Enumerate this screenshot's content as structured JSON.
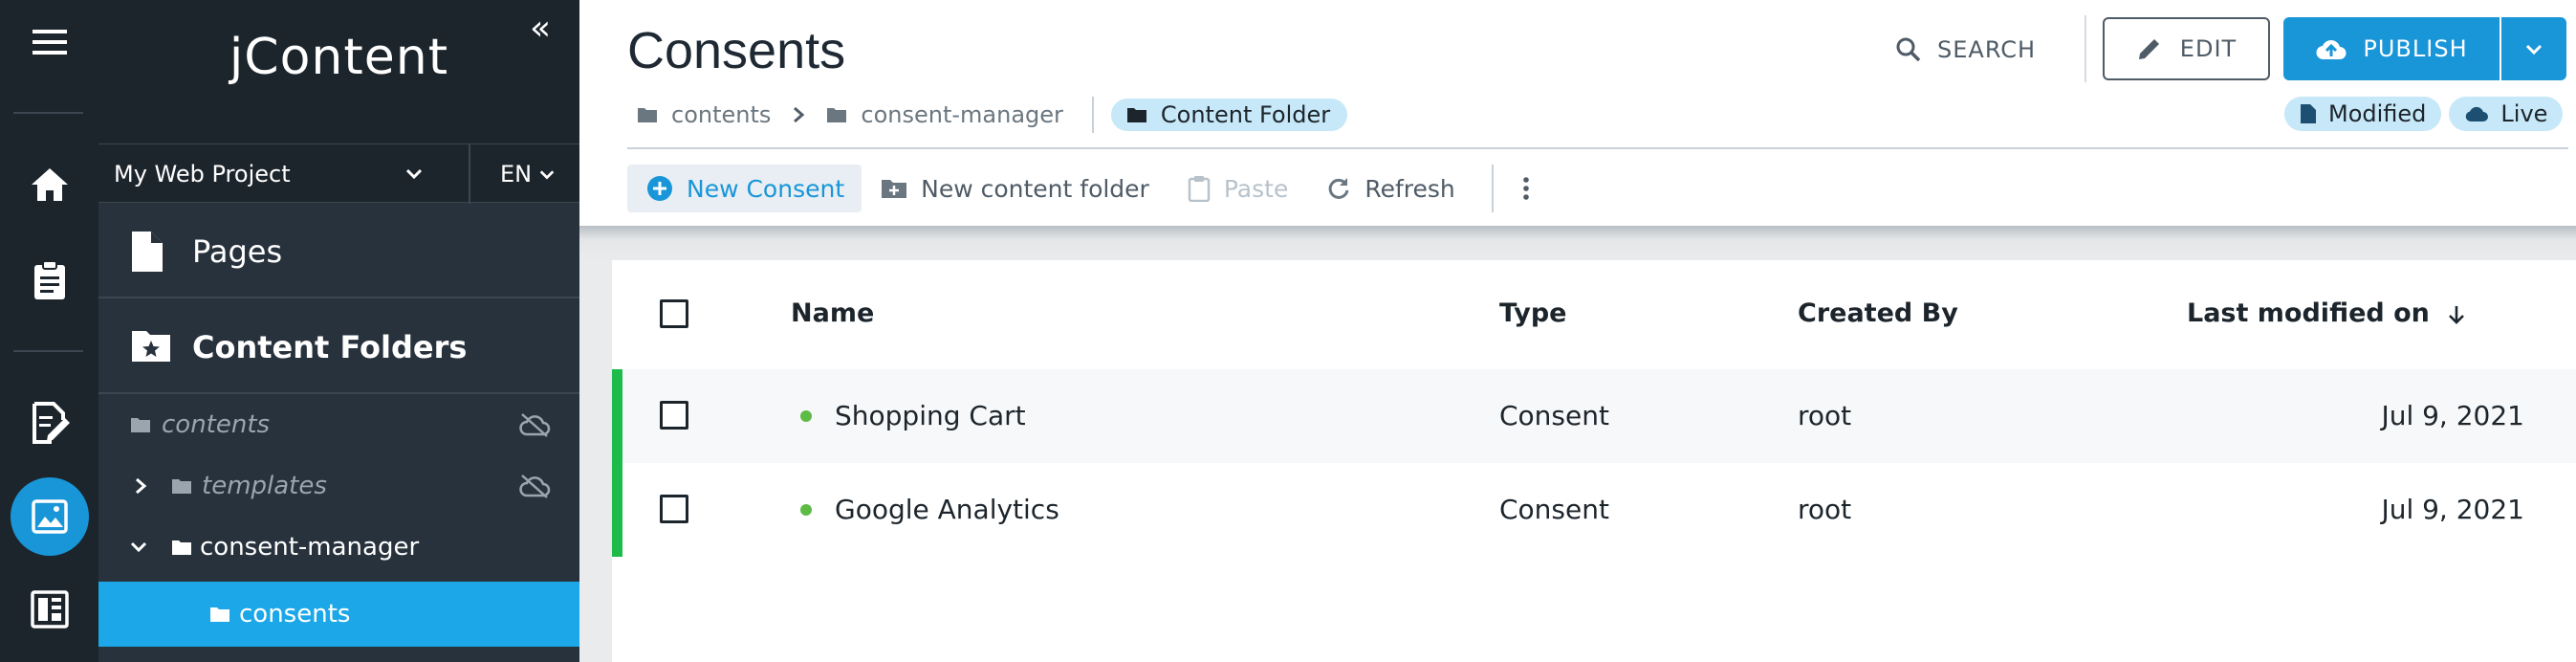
{
  "app": {
    "brand": "jContent"
  },
  "project": {
    "name": "My Web Project",
    "language": "EN"
  },
  "nav": {
    "pages": "Pages",
    "content_folders": "Content Folders"
  },
  "tree": [
    {
      "label": "contents",
      "muted": true,
      "has_chevron": false,
      "cloud_off": true
    },
    {
      "label": "templates",
      "muted": true,
      "has_chevron": true,
      "expanded": false,
      "cloud_off": true
    },
    {
      "label": "consent-manager",
      "muted": false,
      "has_chevron": true,
      "expanded": true,
      "cloud_off": false
    },
    {
      "label": "consents",
      "muted": false,
      "has_chevron": false,
      "selected": true,
      "cloud_off": false
    }
  ],
  "header": {
    "title": "Consents",
    "search_label": "SEARCH",
    "edit_label": "EDIT",
    "publish_label": "PUBLISH"
  },
  "breadcrumb": {
    "items": [
      "contents",
      "consent-manager"
    ],
    "chip": "Content Folder"
  },
  "status": {
    "modified": "Modified",
    "live": "Live"
  },
  "toolbar": {
    "new_consent": "New Consent",
    "new_folder": "New content folder",
    "paste": "Paste",
    "refresh": "Refresh"
  },
  "table": {
    "columns": {
      "name": "Name",
      "type": "Type",
      "created_by": "Created By",
      "last_modified": "Last modified on"
    },
    "rows": [
      {
        "name": "Shopping Cart",
        "type": "Consent",
        "created_by": "root",
        "last_modified": "Jul 9, 2021"
      },
      {
        "name": "Google Analytics",
        "type": "Consent",
        "created_by": "root",
        "last_modified": "Jul 9, 2021"
      }
    ]
  },
  "colors": {
    "accent": "#1896d8",
    "selected": "#1ba7e8",
    "published_dot": "#5dbb46",
    "row_marker": "#1dbb4a"
  }
}
